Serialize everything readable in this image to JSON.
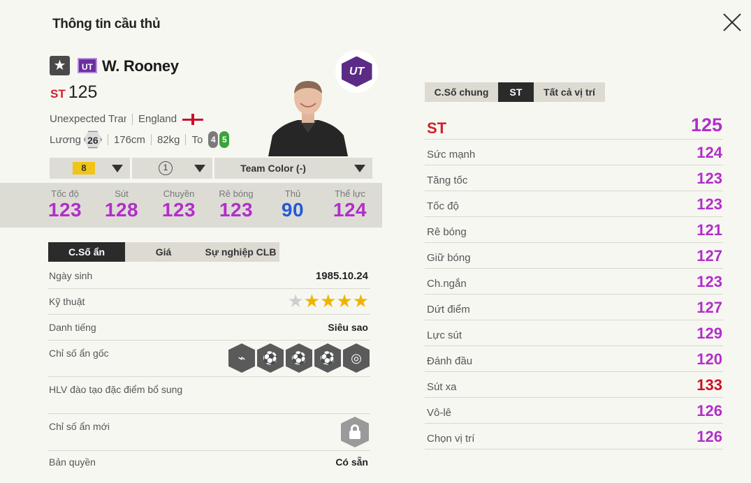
{
  "header": {
    "title": "Thông tin cầu thủ"
  },
  "player": {
    "season_badge": "UT",
    "name": "W. Rooney",
    "position": "ST",
    "ovr": "125",
    "season": "Unexpected Transfer",
    "nation": "England",
    "wage_label": "Lương",
    "wage": "26",
    "height": "176cm",
    "weight": "82kg",
    "body_type": "To",
    "weak_foot_left": "4",
    "weak_foot_right": "5"
  },
  "selectors": {
    "upgrade": "8",
    "skill_level": "1",
    "team_color": "Team Color (-)"
  },
  "summary_stats": [
    {
      "label": "Tốc độ",
      "value": "123"
    },
    {
      "label": "Sút",
      "value": "128"
    },
    {
      "label": "Chuyền",
      "value": "123"
    },
    {
      "label": "Rê bóng",
      "value": "123"
    },
    {
      "label": "Thủ",
      "value": "90"
    },
    {
      "label": "Thể lực",
      "value": "124"
    }
  ],
  "left_tabs": [
    "C.Số ẩn",
    "Giá",
    "Sự nghiệp CLB"
  ],
  "info": {
    "birth_label": "Ngày sinh",
    "birth": "1985.10.24",
    "skill_label": "Kỹ thuật",
    "skill_stars": 4,
    "fame_label": "Danh tiếng",
    "fame": "Siêu sao",
    "traits_label": "Chỉ số ẩn gốc",
    "coach_label": "HLV đào tạo đặc điểm bổ sung",
    "new_traits_label": "Chỉ số ẩn mới",
    "license_label": "Bản quyền",
    "license": "Có sẵn"
  },
  "right_tabs": [
    "C.Số chung",
    "ST",
    "Tất cả vị trí"
  ],
  "detail_stats": [
    {
      "label": "ST",
      "value": "125"
    },
    {
      "label": "Sức mạnh",
      "value": "124"
    },
    {
      "label": "Tăng tốc",
      "value": "123"
    },
    {
      "label": "Tốc độ",
      "value": "123"
    },
    {
      "label": "Rê bóng",
      "value": "121"
    },
    {
      "label": "Giữ bóng",
      "value": "127"
    },
    {
      "label": "Ch.ngắn",
      "value": "123"
    },
    {
      "label": "Dứt điểm",
      "value": "127"
    },
    {
      "label": "Lực sút",
      "value": "129"
    },
    {
      "label": "Đánh đầu",
      "value": "120"
    },
    {
      "label": "Sút xa",
      "value": "133"
    },
    {
      "label": "Vô-lê",
      "value": "126"
    },
    {
      "label": "Chọn vị trí",
      "value": "126"
    }
  ],
  "colors": {
    "stat_purple": "#b22ec9",
    "stat_blue": "#2459d6",
    "stat_red": "#cc1122",
    "position_red": "#d2202c"
  }
}
